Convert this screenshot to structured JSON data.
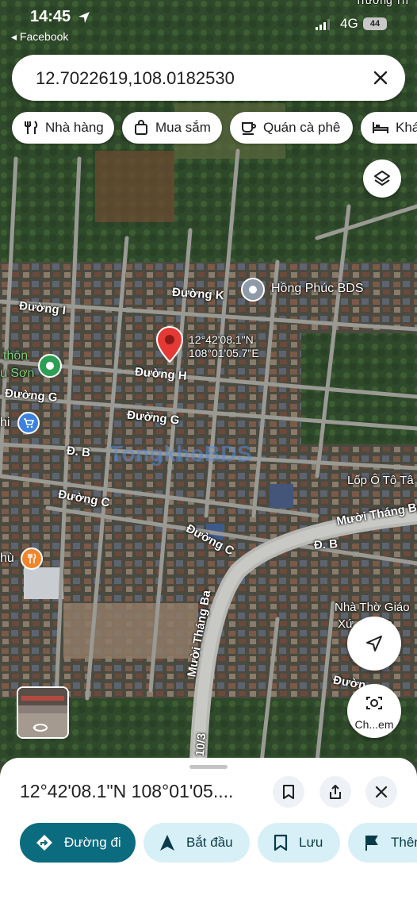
{
  "status_bar": {
    "time": "14:45",
    "back_app": "◂ Facebook",
    "network": "4G",
    "battery": "44"
  },
  "search": {
    "value": "12.7022619,108.0182530"
  },
  "categories": [
    {
      "label": "Nhà hàng",
      "icon": "restaurant-icon"
    },
    {
      "label": "Mua sắm",
      "icon": "shopping-bag-icon"
    },
    {
      "label": "Quán cà phê",
      "icon": "coffee-icon"
    },
    {
      "label": "Khá",
      "icon": "hotel-bed-icon"
    }
  ],
  "map": {
    "roads": {
      "k": "Đường K",
      "i": "Đường I",
      "h": "Đường H",
      "g_left": "Đường G",
      "g": "Đường G",
      "b_left": "Đ. B",
      "c_left": "Đường C",
      "c": "Đường C",
      "b_right": "Đ. B",
      "muoi_thang_ba_right": "Mười Tháng B",
      "muoi_thang_ba": "Mười Tháng Ba",
      "road_103": "10/3",
      "duong_bottom": "Đườn"
    },
    "places": {
      "hong_phuc": "Hồng Phúc BDS",
      "thon": "thôn",
      "u_son": "u Sơn",
      "hi": "hi",
      "hu": "hù",
      "lop_o_to": "Lốp Ô Tô Tâ",
      "nha_tho_1": "Nhà Thờ Giáo",
      "nha_tho_2": "Xứ ... Sơn",
      "truong": "Trường Th"
    },
    "pin_coord_lat": "12°42'08.1\"N",
    "pin_coord_lng": "108°01'05.7\"E",
    "watermark": "TongkhoBDS"
  },
  "controls": {
    "lens_label": "Ch...em"
  },
  "sheet": {
    "title": "12°42'08.1\"N 108°01'05....",
    "actions": [
      {
        "label": "Đường đi",
        "icon": "directions-icon"
      },
      {
        "label": "Bắt đầu",
        "icon": "navigation-arrow-icon"
      },
      {
        "label": "Lưu",
        "icon": "bookmark-icon"
      },
      {
        "label": "Thêm",
        "icon": "flag-icon"
      }
    ]
  },
  "colors": {
    "primary": "#0b6b7f",
    "secondary": "#d7f0f7",
    "pin": "#e53935"
  }
}
